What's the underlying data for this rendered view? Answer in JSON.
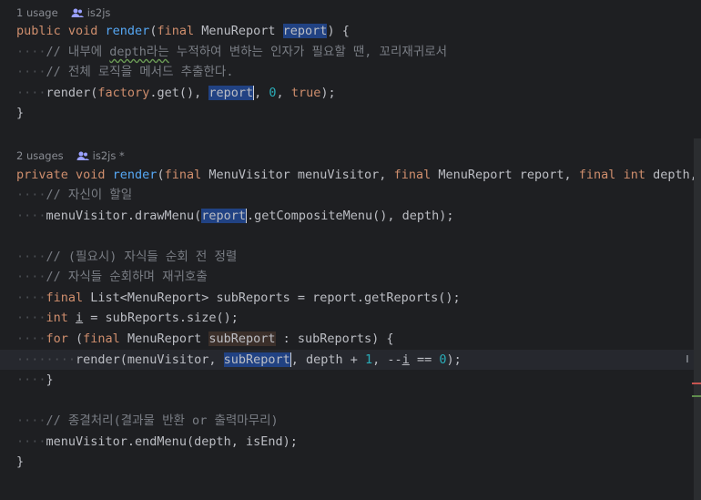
{
  "hints": {
    "render1_usages": "1 usage",
    "render1_author": "is2js",
    "render2_usages": "2 usages",
    "render2_author": "is2js *"
  },
  "code": {
    "l1": {
      "a": "public ",
      "b": "void ",
      "c": "render",
      "d": "(",
      "e": "final ",
      "f": "MenuReport ",
      "g": "report",
      "h": ") {"
    },
    "l2": {
      "a": "// 내부에 ",
      "b": "depth라는",
      "c": " 누적하여 변하는 인자가 필요할 땐, 꼬리재귀로서"
    },
    "l3": {
      "a": "// 전체 로직을 메서드 추출한다."
    },
    "l4": {
      "a": "render(",
      "b": "factory",
      "c": ".get(), ",
      "d": "report",
      "e": ", ",
      "f": "0",
      "g": ", ",
      "h": "true",
      "i": ");"
    },
    "l5": {
      "a": "}"
    },
    "l6": {
      "a": "private ",
      "b": "void ",
      "c": "render",
      "d": "(",
      "e": "final ",
      "f": "MenuVisitor menuVisitor, ",
      "g": "final ",
      "h": "MenuReport report, ",
      "i": "final ",
      "j": "int ",
      "k": "depth, ",
      "l": "f"
    },
    "l7": {
      "a": "// 자신이 할일"
    },
    "l8": {
      "a": "menuVisitor.drawMenu(",
      "b": "report",
      "c": ".getCompositeMenu(), depth);"
    },
    "l9": {
      "a": "// (필요시) 자식들 순회 전 정렬"
    },
    "l10": {
      "a": "// 자식들 순회하며 재귀호출"
    },
    "l11": {
      "a": "final ",
      "b": "List<MenuReport> subReports = report.getReports();"
    },
    "l12": {
      "a": "int ",
      "b": "i",
      "c": " = subReports.size();"
    },
    "l13": {
      "a": "for ",
      "b": "(",
      "c": "final ",
      "d": "MenuReport ",
      "e": "subReport",
      "f": " : subReports) {"
    },
    "l14": {
      "a": "render(menuVisitor, ",
      "b": "subReport",
      "c": ", depth + ",
      "d": "1",
      "e": ", --",
      "f": "i",
      "g": " == ",
      "h": "0",
      "i": ");"
    },
    "l15": {
      "a": "}"
    },
    "l16": {
      "a": "// 종결처리(결과물 반환 or 출력마무리)"
    },
    "l17": {
      "a": "menuVisitor.endMenu(depth, isEnd);"
    },
    "l18": {
      "a": "}"
    }
  },
  "colors": {
    "background": "#1e1f22",
    "keyword": "#cf8e6d",
    "function": "#56a8f5",
    "comment": "#7a7e85",
    "number": "#2aacb8",
    "highlight": "#214283"
  }
}
